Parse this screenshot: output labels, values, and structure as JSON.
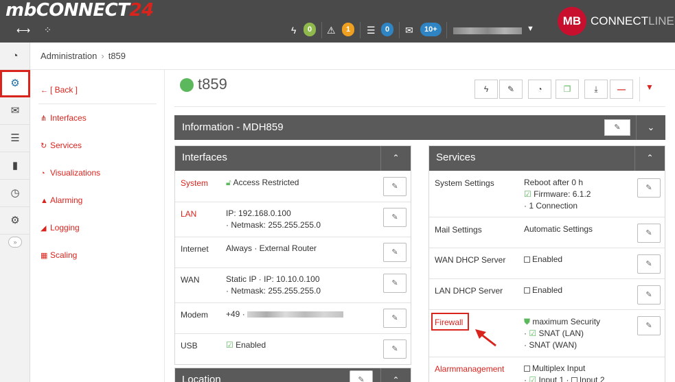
{
  "app": {
    "logo_main": "mbCONNECT",
    "logo_num": "24",
    "brand_badge": "MB",
    "brand_connect": "CONNECT",
    "brand_line": "LINE",
    "user_name_blurred": true
  },
  "topbar": {
    "badges": [
      {
        "icon": "lightning-icon",
        "glyph": "ϟ",
        "count": "0",
        "color": "#8fb94c"
      },
      {
        "icon": "warning-icon",
        "glyph": "⚠",
        "count": "1",
        "color": "#f0a020"
      },
      {
        "icon": "server-icon",
        "glyph": "☰",
        "count": "0",
        "color": "#2f85c4"
      },
      {
        "icon": "mail-icon",
        "glyph": "✉",
        "count": "10+",
        "color": "#2f85c4"
      }
    ]
  },
  "breadcrumb": {
    "root": "Administration",
    "separator": "›",
    "current": "t859"
  },
  "leftnav": {
    "back": "[ Back ]",
    "items": [
      "Interfaces",
      "Services",
      "Visualizations",
      "Alarming",
      "Logging",
      "Scaling"
    ]
  },
  "device": {
    "name": "t859",
    "status_color": "#5cb85c"
  },
  "info_bar": {
    "title": "Information - MDH859"
  },
  "interfaces_panel": {
    "title": "Interfaces",
    "rows": [
      {
        "label": "System",
        "red": true,
        "lines": [
          "Access Restricted"
        ]
      },
      {
        "label": "LAN",
        "red": true,
        "lines": [
          "IP: 192.168.0.100",
          "· Netmask: 255.255.255.0"
        ]
      },
      {
        "label": "Internet",
        "red": false,
        "lines": [
          "Always   · External Router"
        ]
      },
      {
        "label": "WAN",
        "red": false,
        "lines": [
          "Static IP   · IP: 10.10.0.100",
          "· Netmask: 255.255.255.0"
        ]
      },
      {
        "label": "Modem",
        "red": false,
        "lines": [
          "+49  ·"
        ]
      },
      {
        "label": "USB",
        "red": false,
        "lines": [
          "Enabled"
        ]
      }
    ]
  },
  "location_panel": {
    "title": "Location"
  },
  "services_panel": {
    "title": "Services",
    "rows": [
      {
        "label": "System Settings",
        "red": false,
        "lines": [
          "Reboot after 0 h",
          "Firmware: 6.1.2",
          "· 1 Connection"
        ]
      },
      {
        "label": "Mail Settings",
        "red": false,
        "lines": [
          "Automatic Settings"
        ]
      },
      {
        "label": "WAN DHCP Server",
        "red": false,
        "lines": [
          "Enabled"
        ]
      },
      {
        "label": "LAN DHCP Server",
        "red": false,
        "lines": [
          "Enabled"
        ]
      },
      {
        "label": "Firewall",
        "red": true,
        "lines": [
          "maximum Security",
          "SNAT (LAN)",
          "· SNAT (WAN)"
        ]
      },
      {
        "label": "Alarmmanagement",
        "red": true,
        "lines": [
          "Multiplex Input",
          "Input 1",
          "Input 2"
        ]
      }
    ]
  }
}
